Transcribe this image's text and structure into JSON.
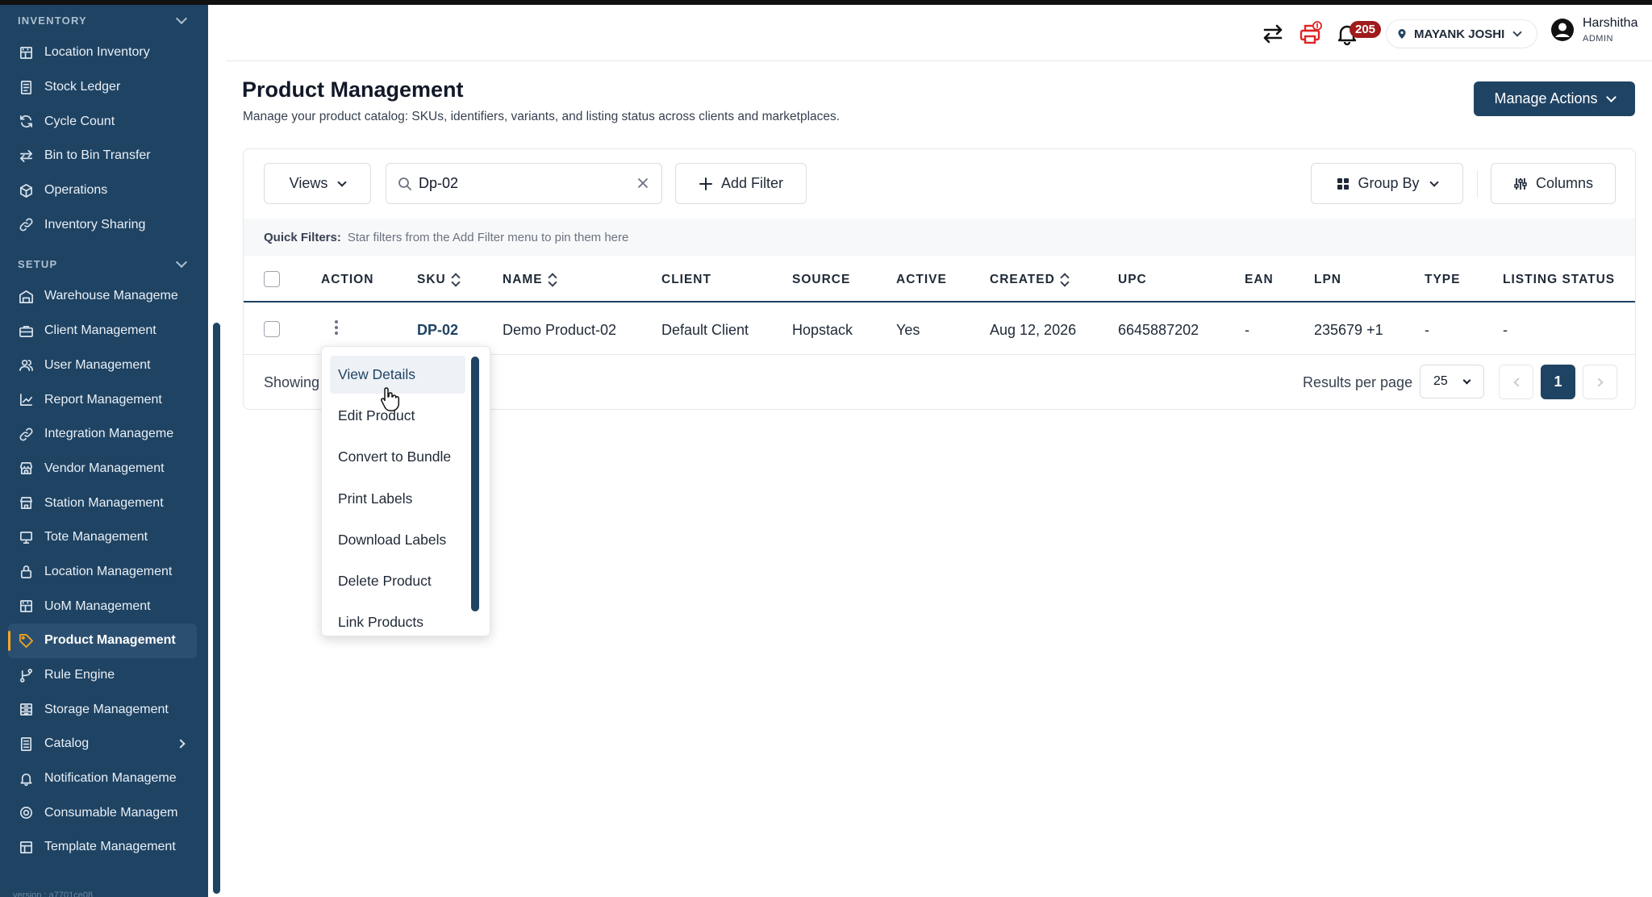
{
  "sidebar": {
    "sections": [
      {
        "label": "INVENTORY"
      },
      {
        "label": "SETUP"
      }
    ],
    "inventory_items": [
      {
        "label": "Location Inventory",
        "icon": "building-icon"
      },
      {
        "label": "Stock Ledger",
        "icon": "ledger-icon"
      },
      {
        "label": "Cycle Count",
        "icon": "refresh-icon"
      },
      {
        "label": "Bin to Bin Transfer",
        "icon": "transfer-icon"
      },
      {
        "label": "Operations",
        "icon": "cube-icon"
      },
      {
        "label": "Inventory Sharing",
        "icon": "link-icon"
      }
    ],
    "setup_items": [
      {
        "label": "Warehouse Manageme",
        "icon": "warehouse-icon"
      },
      {
        "label": "Client Management",
        "icon": "briefcase-icon"
      },
      {
        "label": "User Management",
        "icon": "users-icon"
      },
      {
        "label": "Report Management",
        "icon": "chart-icon"
      },
      {
        "label": "Integration Manageme",
        "icon": "link-icon"
      },
      {
        "label": "Vendor Management",
        "icon": "store-icon"
      },
      {
        "label": "Station Management",
        "icon": "station-icon"
      },
      {
        "label": "Tote Management",
        "icon": "monitor-icon"
      },
      {
        "label": "Location Management",
        "icon": "lock-icon"
      },
      {
        "label": "UoM Management",
        "icon": "building-icon"
      },
      {
        "label": "Product Management",
        "icon": "tag-icon",
        "active": true
      },
      {
        "label": "Rule Engine",
        "icon": "flow-icon"
      },
      {
        "label": "Storage Management",
        "icon": "storage-icon"
      },
      {
        "label": "Catalog",
        "icon": "book-icon"
      },
      {
        "label": "Notification Manageme",
        "icon": "bell-icon"
      },
      {
        "label": "Consumable Managem",
        "icon": "target-icon"
      },
      {
        "label": "Template Management",
        "icon": "template-icon"
      }
    ],
    "version": "version : a7701ce08"
  },
  "header": {
    "notification_count": "205",
    "location": "MAYANK JOSHI",
    "user_name": "Harshitha",
    "user_role": "ADMIN"
  },
  "page": {
    "title": "Product Management",
    "subtitle": "Manage your product catalog: SKUs, identifiers, variants, and listing status across clients and marketplaces.",
    "manage_actions": "Manage Actions"
  },
  "toolbar": {
    "views": "Views",
    "search_value": "Dp-02",
    "add_filter": "Add Filter",
    "group_by": "Group By",
    "columns": "Columns"
  },
  "quick_filters": {
    "label": "Quick Filters:",
    "hint": "Star filters from the Add Filter menu to pin them here"
  },
  "table": {
    "headers": [
      "ACTION",
      "SKU",
      "NAME",
      "CLIENT",
      "SOURCE",
      "ACTIVE",
      "CREATED",
      "UPC",
      "EAN",
      "LPN",
      "TYPE",
      "LISTING STATUS"
    ],
    "row": {
      "sku": "DP-02",
      "name": "Demo Product-02",
      "client": "Default Client",
      "source": "Hopstack",
      "active": "Yes",
      "created": "Aug 12, 2026",
      "upc": "6645887202",
      "ean": "-",
      "lpn": "235679 +1",
      "type": "-",
      "listing_status": "-"
    }
  },
  "footer": {
    "showing": "Showing",
    "results_per_page": "Results per page",
    "per_page_value": "25",
    "current_page": "1"
  },
  "action_menu": {
    "items": [
      "View Details",
      "Edit Product",
      "Convert to Bundle",
      "Print Labels",
      "Download Labels",
      "Delete Product",
      "Link Products"
    ],
    "hovered": "View Details"
  },
  "colors": {
    "sidebar_bg": "#1f4363",
    "accent": "#f5a623",
    "primary": "#1f4363",
    "badge": "#a01b1b"
  }
}
